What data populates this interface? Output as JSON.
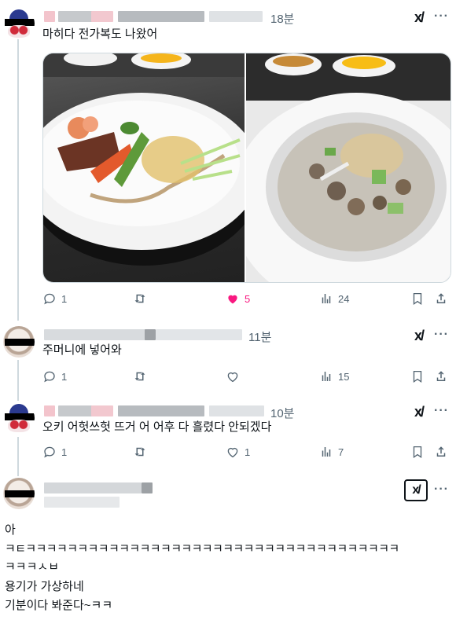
{
  "tweets": [
    {
      "time": "18분",
      "text": "마히다 전가복도 나왔어",
      "actions": {
        "replies": "1",
        "likes": "5",
        "views": "24"
      }
    },
    {
      "time": "11분",
      "text": "주머니에 넣어와",
      "actions": {
        "replies": "1",
        "likes": "",
        "views": "15"
      }
    },
    {
      "time": "10분",
      "text": "오키 어헛쓰헛 뜨거 어 어후 다 흘렸다 안되겠다",
      "actions": {
        "replies": "1",
        "likes": "1",
        "views": "7"
      }
    },
    {
      "text_lines": [
        "아",
        "ㅋㅌㅋㅋㅋㅋㅋㅋㅋㅋㅋㅋㅋㅋㅋㅋㅋㅋㅋㅋㅋㅋㅋㅋㅋㅋㅋㅋㅋㅋㅋㅋㅋㅋㅋㅋㅋㅋ",
        "ㅋㅋㅋㅅㅂ",
        "용기가 가상하네",
        "기분이다 봐준다~ㅋㅋ"
      ]
    }
  ],
  "colors": {
    "like_active": "#f91880",
    "secondary_text": "#536471",
    "thread_line": "#cfd9de"
  }
}
